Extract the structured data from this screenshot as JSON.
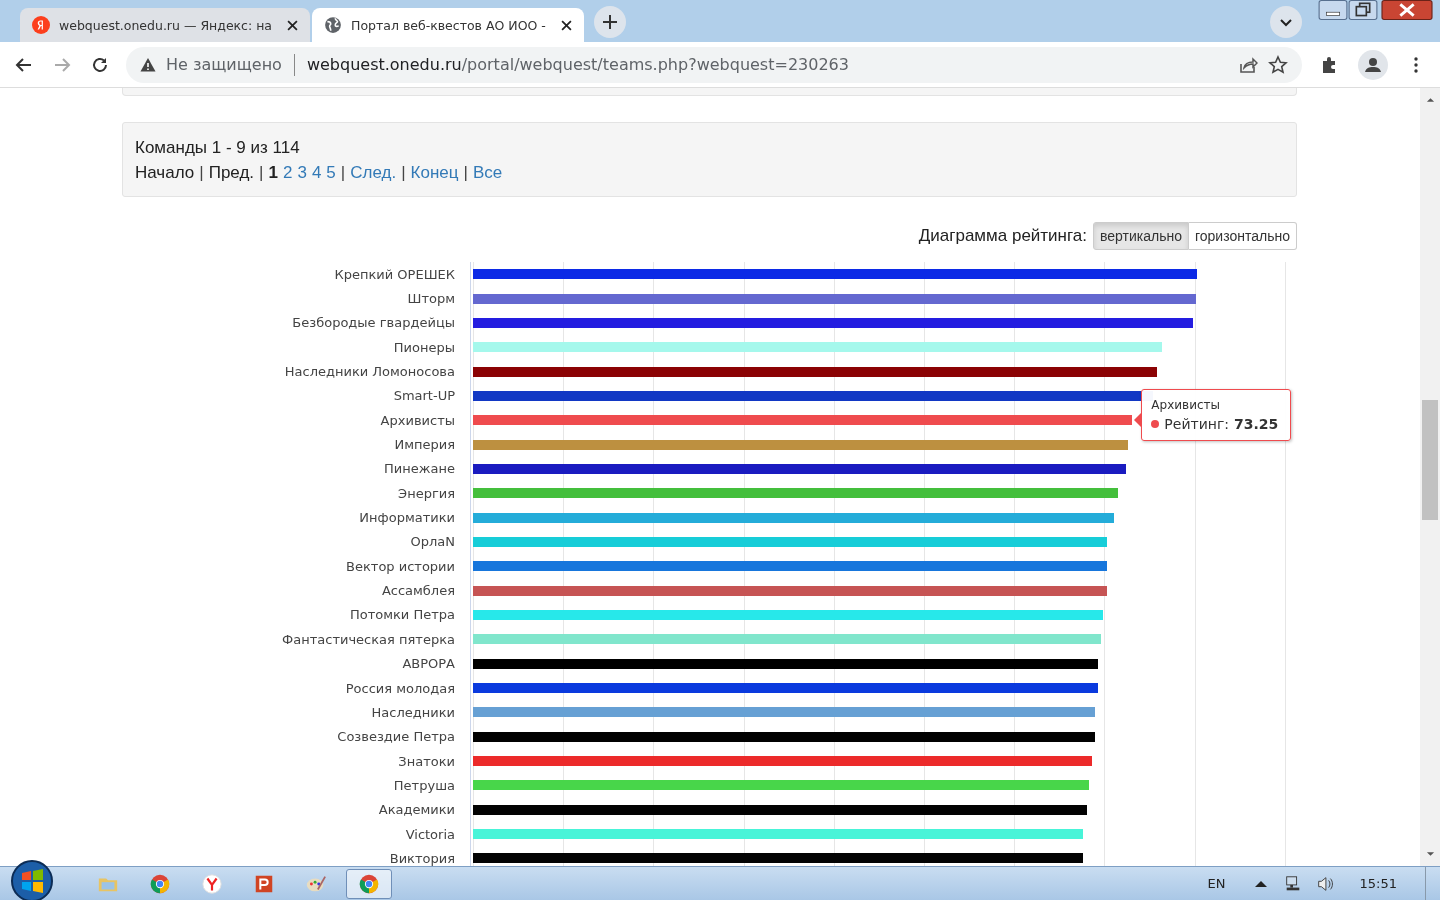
{
  "browser": {
    "tabs": [
      {
        "title": "webquest.onedu.ru — Яндекс: на",
        "selected": false,
        "kind": "yandex"
      },
      {
        "title": "Портал веб-квестов АО ИОО -",
        "selected": true,
        "kind": "globe"
      }
    ],
    "security": "Не защищено",
    "url_host": "webquest.onedu.ru",
    "url_path": "/portal/webquest/teams.php?webquest=230263"
  },
  "pagination": {
    "summary": "Команды 1 - 9 из 114",
    "items": [
      {
        "kind": "text",
        "label": "Начало"
      },
      {
        "kind": "sep",
        "label": "|"
      },
      {
        "kind": "text",
        "label": "Пред."
      },
      {
        "kind": "sep",
        "label": "|"
      },
      {
        "kind": "page",
        "label": "1",
        "selected": true
      },
      {
        "kind": "page",
        "label": "2",
        "selected": false
      },
      {
        "kind": "page",
        "label": "3",
        "selected": false
      },
      {
        "kind": "page",
        "label": "4",
        "selected": false
      },
      {
        "kind": "page",
        "label": "5",
        "selected": false
      },
      {
        "kind": "sep",
        "label": "|"
      },
      {
        "kind": "link",
        "label": "След."
      },
      {
        "kind": "sep",
        "label": "|"
      },
      {
        "kind": "link",
        "label": "Конец"
      },
      {
        "kind": "sep",
        "label": "|"
      },
      {
        "kind": "link",
        "label": "Все"
      }
    ]
  },
  "chart": {
    "label": "Диаграмма рейтинга:",
    "views": [
      {
        "label": "вертикально",
        "selected": true
      },
      {
        "label": "горизонтально",
        "selected": false
      }
    ],
    "teams": [
      {
        "name": "Крепкий ОРЕШЕК",
        "color": "#0c2ae6",
        "level": 0.892
      },
      {
        "name": "Шторм",
        "color": "#6468d0",
        "level": 0.89
      },
      {
        "name": "Безбородые гвардейцы",
        "color": "#241de0",
        "level": 0.887
      },
      {
        "name": "Пионеры",
        "color": "#a5f8ec",
        "level": 0.849
      },
      {
        "name": "Наследники Ломоносова",
        "color": "#8b0204",
        "level": 0.842
      },
      {
        "name": "Smart-UP",
        "color": "#1238c4",
        "level": 0.837
      },
      {
        "name": "Архивисты",
        "color": "#ef4b4e",
        "level": 0.812,
        "hovered": true
      },
      {
        "name": "Империя",
        "color": "#bd9040",
        "level": 0.807
      },
      {
        "name": "Пинежане",
        "color": "#1a1bc0",
        "level": 0.804
      },
      {
        "name": "Энергия",
        "color": "#44bf3c",
        "level": 0.794
      },
      {
        "name": "Информатики",
        "color": "#24acd9",
        "level": 0.789
      },
      {
        "name": "ОрлаN",
        "color": "#17cdd8",
        "level": 0.781
      },
      {
        "name": "Вектор истории",
        "color": "#1776dc",
        "level": 0.781
      },
      {
        "name": "Ассамблея",
        "color": "#c65454",
        "level": 0.781
      },
      {
        "name": "Потомки Петра",
        "color": "#27e8ea",
        "level": 0.776
      },
      {
        "name": "Фантастическая пятерка",
        "color": "#80e6cc",
        "level": 0.773
      },
      {
        "name": "АВРОРА",
        "color": "#000000",
        "level": 0.77
      },
      {
        "name": "Россия молодая",
        "color": "#0a3ade",
        "level": 0.77
      },
      {
        "name": "Наследники",
        "color": "#66a0d4",
        "level": 0.766
      },
      {
        "name": "Созвездие Петра",
        "color": "#010101",
        "level": 0.766
      },
      {
        "name": "Знатоки",
        "color": "#ec2a2a",
        "level": 0.762
      },
      {
        "name": "Петруша",
        "color": "#48d64a",
        "level": 0.759
      },
      {
        "name": "Академики",
        "color": "#020202",
        "level": 0.756
      },
      {
        "name": "Victoria",
        "color": "#48f4d8",
        "level": 0.751
      },
      {
        "name": "Виктория",
        "color": "#030303",
        "level": 0.751
      }
    ],
    "tooltip": {
      "title": "Архивисты",
      "label": "Рейтинг:",
      "value": "73.25"
    }
  },
  "taskbar": {
    "apps": [
      {
        "kind": "explorer",
        "selected": false
      },
      {
        "kind": "chrome",
        "selected": false
      },
      {
        "kind": "yandex",
        "selected": false
      },
      {
        "kind": "powerpoint",
        "selected": false
      },
      {
        "kind": "paint",
        "selected": false
      },
      {
        "kind": "chrome",
        "selected": true
      }
    ],
    "language": "EN",
    "time": "15:51"
  }
}
